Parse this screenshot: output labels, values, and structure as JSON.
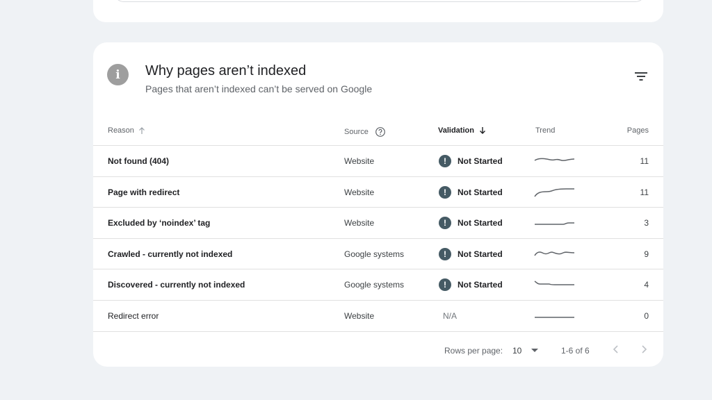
{
  "colors": {
    "background": "#eff2f5",
    "card": "#ffffff",
    "warning": "#455a64",
    "info": "#9e9e9e"
  },
  "header": {
    "icon": "info-icon",
    "title": "Why pages aren’t indexed",
    "subtitle": "Pages that aren’t indexed can’t be served on Google",
    "filter_icon": "filter-icon"
  },
  "table": {
    "columns": {
      "reason": "Reason",
      "source": "Source",
      "validation": "Validation",
      "trend": "Trend",
      "pages": "Pages"
    },
    "rows": [
      {
        "reason": "Not found (404)",
        "source": "Website",
        "validation": "Not Started",
        "pages": "11"
      },
      {
        "reason": "Page with redirect",
        "source": "Website",
        "validation": "Not Started",
        "pages": "11"
      },
      {
        "reason": "Excluded by ‘noindex’ tag",
        "source": "Website",
        "validation": "Not Started",
        "pages": "3"
      },
      {
        "reason": "Crawled - currently not indexed",
        "source": "Google systems",
        "validation": "Not Started",
        "pages": "9"
      },
      {
        "reason": "Discovered - currently not indexed",
        "source": "Google systems",
        "validation": "Not Started",
        "pages": "4"
      },
      {
        "reason": "Redirect error",
        "source": "Website",
        "validation": "N/A",
        "pages": "0"
      }
    ]
  },
  "pagination": {
    "rows_per_page_label": "Rows per page:",
    "rows_per_page_value": "10",
    "range": "1-6 of 6"
  }
}
